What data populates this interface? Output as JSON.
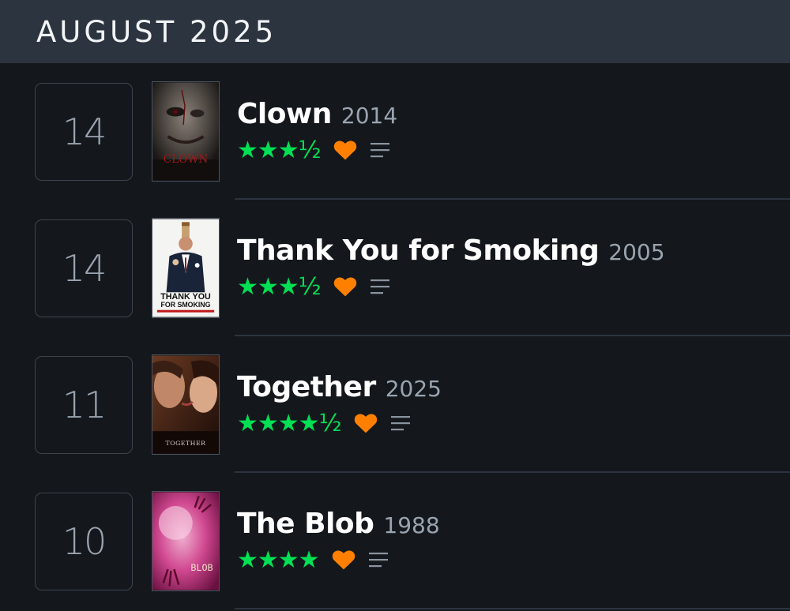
{
  "header": {
    "month_title": "AUGUST 2025"
  },
  "colors": {
    "star": "#00e054",
    "heart": "#ff8000",
    "header_bg": "#2c3440",
    "background": "#14181c"
  },
  "entries": [
    {
      "day": "14",
      "title": "Clown",
      "year": "2014",
      "stars": "★★★½",
      "rating": 3.5,
      "liked": true,
      "poster_text": "CLOWN"
    },
    {
      "day": "14",
      "title": "Thank You for Smoking",
      "year": "2005",
      "stars": "★★★½",
      "rating": 3.5,
      "liked": true,
      "poster_text": "THANK YOU",
      "poster_text_2": "FOR SMOKING"
    },
    {
      "day": "11",
      "title": "Together",
      "year": "2025",
      "stars": "★★★★½",
      "rating": 4.5,
      "liked": true,
      "poster_text": "TOGETHER"
    },
    {
      "day": "10",
      "title": "The Blob",
      "year": "1988",
      "stars": "★★★★",
      "rating": 4.0,
      "liked": true,
      "poster_text": "BLOB"
    }
  ]
}
